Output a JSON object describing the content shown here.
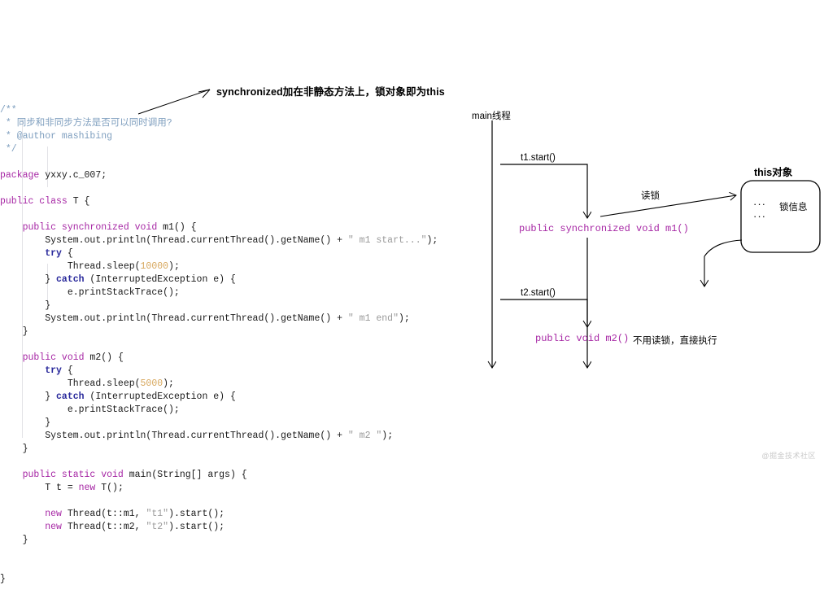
{
  "code": {
    "language": "java",
    "lines": [
      {
        "indent": 0,
        "segments": [
          {
            "t": "/**",
            "c": "cmt"
          }
        ]
      },
      {
        "indent": 0,
        "segments": [
          {
            "t": " * 同步和非同步方法是否可以同时调用?",
            "c": "cmt"
          }
        ]
      },
      {
        "indent": 0,
        "segments": [
          {
            "t": " * @author mashibing",
            "c": "cmt"
          }
        ]
      },
      {
        "indent": 0,
        "segments": [
          {
            "t": " */",
            "c": "cmt"
          }
        ]
      },
      {
        "indent": 0,
        "segments": []
      },
      {
        "indent": 0,
        "segments": [
          {
            "t": "package",
            "c": "kw"
          },
          {
            "t": " yxxy.c_007;",
            "c": "plain"
          }
        ]
      },
      {
        "indent": 0,
        "segments": []
      },
      {
        "indent": 0,
        "segments": [
          {
            "t": "public class",
            "c": "kw"
          },
          {
            "t": " T {",
            "c": "plain"
          }
        ]
      },
      {
        "indent": 0,
        "segments": []
      },
      {
        "indent": 1,
        "segments": [
          {
            "t": "public synchronized void",
            "c": "kw"
          },
          {
            "t": " m1() {",
            "c": "plain"
          }
        ]
      },
      {
        "indent": 2,
        "segments": [
          {
            "t": "System.out.println(Thread.currentThread().getName() + ",
            "c": "plain"
          },
          {
            "t": "\" m1 start...\"",
            "c": "str"
          },
          {
            "t": ");",
            "c": "plain"
          }
        ]
      },
      {
        "indent": 2,
        "segments": [
          {
            "t": "try",
            "c": "ctl"
          },
          {
            "t": " {",
            "c": "plain"
          }
        ]
      },
      {
        "indent": 3,
        "segments": [
          {
            "t": "Thread.sleep(",
            "c": "plain"
          },
          {
            "t": "10000",
            "c": "num"
          },
          {
            "t": ");",
            "c": "plain"
          }
        ]
      },
      {
        "indent": 2,
        "segments": [
          {
            "t": "} ",
            "c": "plain"
          },
          {
            "t": "catch",
            "c": "ctl"
          },
          {
            "t": " (InterruptedException e) {",
            "c": "plain"
          }
        ]
      },
      {
        "indent": 3,
        "segments": [
          {
            "t": "e.printStackTrace();",
            "c": "plain"
          }
        ]
      },
      {
        "indent": 2,
        "segments": [
          {
            "t": "}",
            "c": "plain"
          }
        ]
      },
      {
        "indent": 2,
        "segments": [
          {
            "t": "System.out.println(Thread.currentThread().getName() + ",
            "c": "plain"
          },
          {
            "t": "\" m1 end\"",
            "c": "str"
          },
          {
            "t": ");",
            "c": "plain"
          }
        ]
      },
      {
        "indent": 1,
        "segments": [
          {
            "t": "}",
            "c": "plain"
          }
        ]
      },
      {
        "indent": 0,
        "segments": []
      },
      {
        "indent": 1,
        "segments": [
          {
            "t": "public void",
            "c": "kw"
          },
          {
            "t": " m2() {",
            "c": "plain"
          }
        ]
      },
      {
        "indent": 2,
        "segments": [
          {
            "t": "try",
            "c": "ctl"
          },
          {
            "t": " {",
            "c": "plain"
          }
        ]
      },
      {
        "indent": 3,
        "segments": [
          {
            "t": "Thread.sleep(",
            "c": "plain"
          },
          {
            "t": "5000",
            "c": "num"
          },
          {
            "t": ");",
            "c": "plain"
          }
        ]
      },
      {
        "indent": 2,
        "segments": [
          {
            "t": "} ",
            "c": "plain"
          },
          {
            "t": "catch",
            "c": "ctl"
          },
          {
            "t": " (InterruptedException e) {",
            "c": "plain"
          }
        ]
      },
      {
        "indent": 3,
        "segments": [
          {
            "t": "e.printStackTrace();",
            "c": "plain"
          }
        ]
      },
      {
        "indent": 2,
        "segments": [
          {
            "t": "}",
            "c": "plain"
          }
        ]
      },
      {
        "indent": 2,
        "segments": [
          {
            "t": "System.out.println(Thread.currentThread().getName() + ",
            "c": "plain"
          },
          {
            "t": "\" m2 \"",
            "c": "str"
          },
          {
            "t": ");",
            "c": "plain"
          }
        ]
      },
      {
        "indent": 1,
        "segments": [
          {
            "t": "}",
            "c": "plain"
          }
        ]
      },
      {
        "indent": 0,
        "segments": []
      },
      {
        "indent": 1,
        "segments": [
          {
            "t": "public static void",
            "c": "kw"
          },
          {
            "t": " main(String[] args) {",
            "c": "plain"
          }
        ]
      },
      {
        "indent": 2,
        "segments": [
          {
            "t": "T t = ",
            "c": "plain"
          },
          {
            "t": "new",
            "c": "kw"
          },
          {
            "t": " T();",
            "c": "plain"
          }
        ]
      },
      {
        "indent": 0,
        "segments": []
      },
      {
        "indent": 2,
        "segments": [
          {
            "t": "new",
            "c": "kw"
          },
          {
            "t": " Thread(t::m1, ",
            "c": "plain"
          },
          {
            "t": "\"t1\"",
            "c": "str"
          },
          {
            "t": ").start();",
            "c": "plain"
          }
        ]
      },
      {
        "indent": 2,
        "segments": [
          {
            "t": "new",
            "c": "kw"
          },
          {
            "t": " Thread(t::m2, ",
            "c": "plain"
          },
          {
            "t": "\"t2\"",
            "c": "str"
          },
          {
            "t": ").start();",
            "c": "plain"
          }
        ]
      },
      {
        "indent": 1,
        "segments": [
          {
            "t": "}",
            "c": "plain"
          }
        ]
      },
      {
        "indent": 0,
        "segments": []
      },
      {
        "indent": 0,
        "segments": []
      },
      {
        "indent": 0,
        "segments": [
          {
            "t": "}",
            "c": "plain"
          }
        ]
      }
    ]
  },
  "annotation": {
    "callout_text": "synchronized加在非静态方法上，锁对象即为this"
  },
  "diagram": {
    "main_thread_label": "main线程",
    "t1_start_label": "t1.start()",
    "t2_start_label": "t2.start()",
    "m1_signature": "public synchronized void m1()",
    "m2_signature": "public void m2()",
    "read_lock_label": "读锁",
    "m2_note": "不用读锁，直接执行",
    "this_object_title": "this对象",
    "lock_info_label": "锁信息",
    "dots_top": "···",
    "dots_bottom": "···"
  },
  "watermark": {
    "text": "@掘金技术社区"
  },
  "colors": {
    "background": "#ffffff",
    "comment": "#7f9fbf",
    "keyword": "#a626a4",
    "control": "#2a2a9c",
    "number": "#d7a75c",
    "string": "#9a9a9a",
    "plain_text": "#1a1a1a",
    "diagram_stroke": "#000000",
    "watermark": "#c9c9c9"
  }
}
